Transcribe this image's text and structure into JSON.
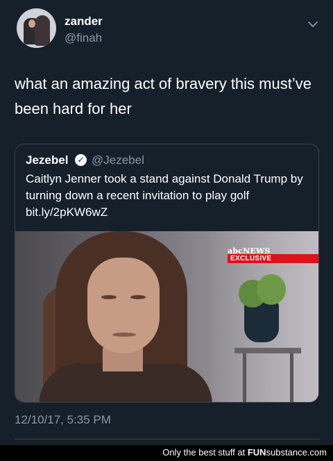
{
  "tweet": {
    "display_name": "zander",
    "handle": "@finah",
    "text": "what an amazing act of bravery this must’ve been hard for her",
    "timestamp": "12/10/17, 5:35 PM"
  },
  "quoted_tweet": {
    "display_name": "Jezebel",
    "verified_icon": "verified-badge-icon",
    "handle": "@Jezebel",
    "text": "Caitlyn Jenner took a stand against Donald Trump by turning down a recent invitation to play golf bit.ly/2pKW6wZ",
    "media": {
      "network_logo": "abcNEWS",
      "banner": "EXCLUSIVE",
      "banner_color": "#d9141b"
    }
  },
  "footer": {
    "prefix": "Only the best stuff at",
    "brand_bold": "FUN",
    "brand_rest": "substance.com"
  },
  "colors": {
    "background": "#15202b",
    "secondary_text": "#8899a6",
    "border": "#38444d"
  }
}
